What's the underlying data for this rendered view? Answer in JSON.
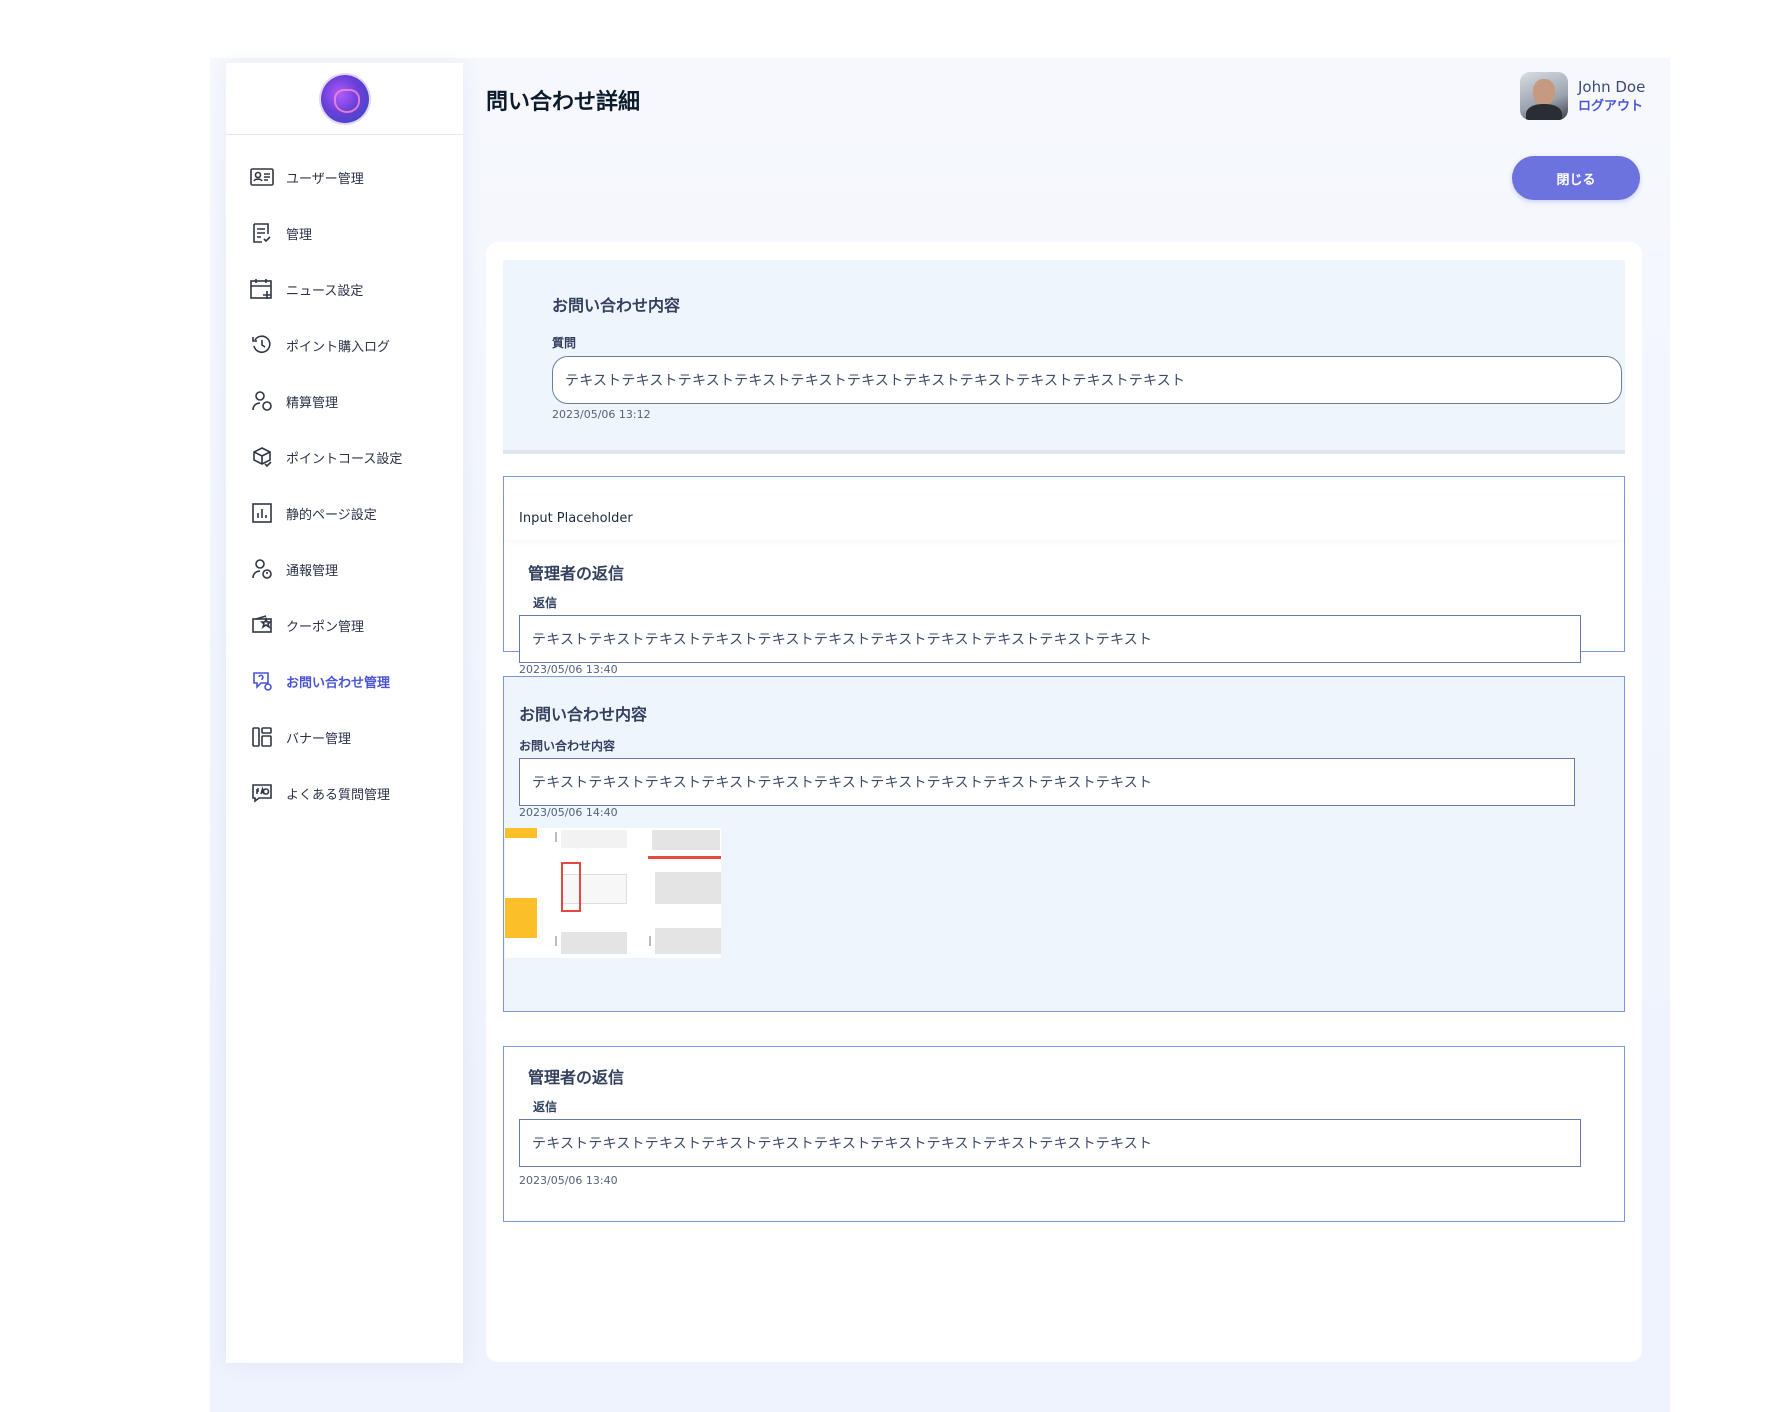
{
  "header": {
    "title": "問い合わせ詳細",
    "user_name": "John Doe",
    "logout_label": "ログアウト",
    "close_label": "閉じる"
  },
  "sidebar": {
    "items": [
      {
        "label": "ユーザー管理",
        "icon": "user-card-icon"
      },
      {
        "label": "管理",
        "icon": "document-check-icon"
      },
      {
        "label": "ニュース設定",
        "icon": "calendar-add-icon"
      },
      {
        "label": "ポイント購入ログ",
        "icon": "history-icon"
      },
      {
        "label": "精算管理",
        "icon": "user-settle-icon"
      },
      {
        "label": "ポイントコース設定",
        "icon": "box-check-icon"
      },
      {
        "label": "静的ページ設定",
        "icon": "chart-page-icon"
      },
      {
        "label": "通報管理",
        "icon": "user-alert-icon"
      },
      {
        "label": "クーポン管理",
        "icon": "coupon-icon"
      },
      {
        "label": "お問い合わせ管理",
        "icon": "inquiry-icon",
        "active": true
      },
      {
        "label": "バナー管理",
        "icon": "banner-layout-icon"
      },
      {
        "label": "よくある質問管理",
        "icon": "faq-icon"
      }
    ]
  },
  "inquiry_top": {
    "heading": "お問い合わせ内容",
    "label": "質問",
    "value": "テキストテキストテキストテキストテキストテキストテキストテキストテキストテキストテキスト",
    "date": "2023/05/06 13:12"
  },
  "reply_1": {
    "placeholder": "Input Placeholder",
    "heading": "管理者の返信",
    "label": "返信",
    "value": "テキストテキストテキストテキストテキストテキストテキストテキストテキストテキストテキスト",
    "date": "2023/05/06 13:40"
  },
  "inquiry_2": {
    "heading": "お問い合わせ内容",
    "label": "お問い合わせ内容",
    "value": "テキストテキストテキストテキストテキストテキストテキストテキストテキストテキストテキスト",
    "date": "2023/05/06 14:40"
  },
  "reply_2": {
    "heading": "管理者の返信",
    "label": "返信",
    "value": "テキストテキストテキストテキストテキストテキストテキストテキストテキストテキストテキスト",
    "date": "2023/05/06 13:40"
  },
  "colors": {
    "accent": "#4b55d6",
    "button": "#6c72de",
    "panel": "#eef5fd",
    "border": "#7e97d6"
  }
}
